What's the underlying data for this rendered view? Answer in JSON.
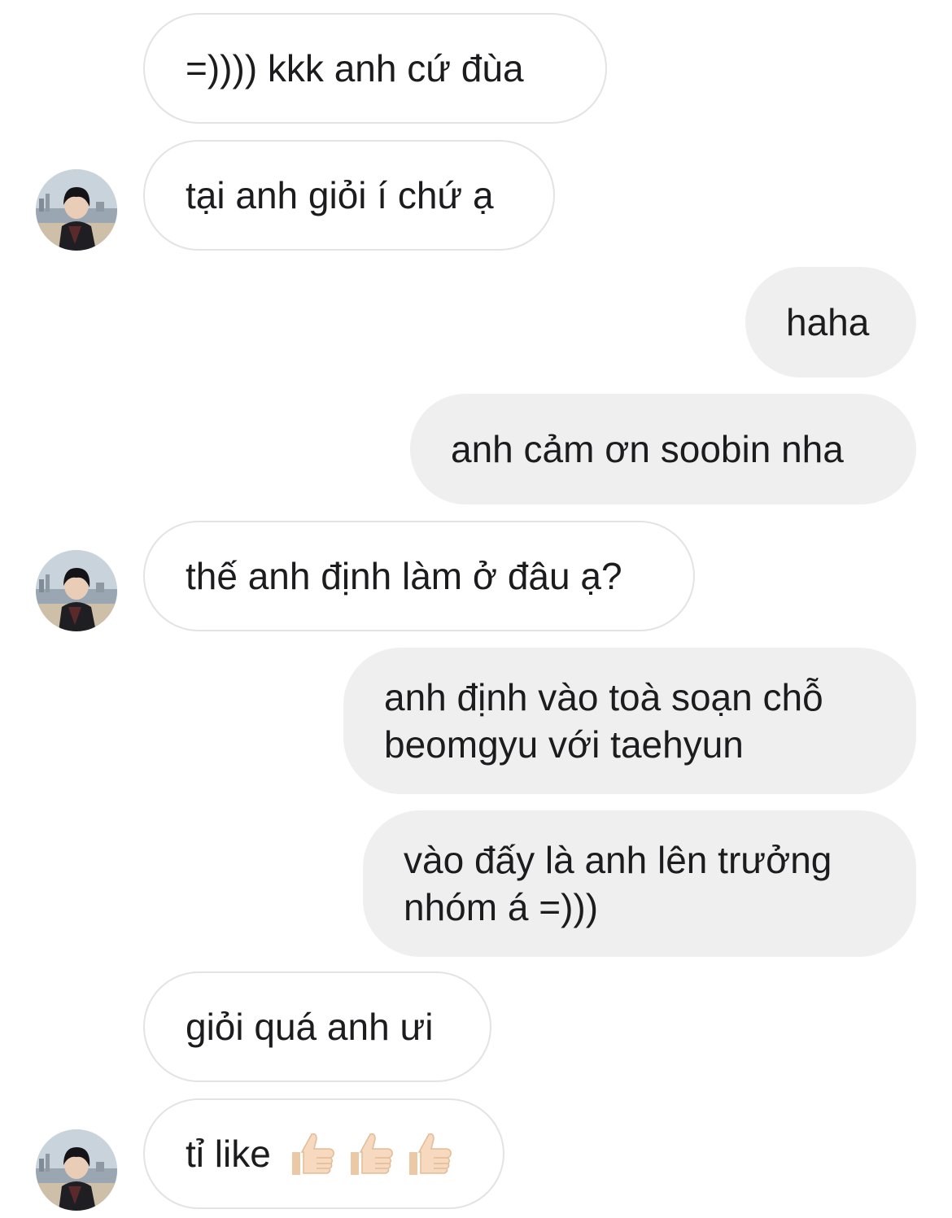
{
  "messages": [
    {
      "side": "in",
      "text": "=)))) kkk anh cứ đùa"
    },
    {
      "side": "in",
      "text": "tại anh giỏi í chứ ạ",
      "avatar": true
    },
    {
      "side": "out",
      "text": "haha"
    },
    {
      "side": "out",
      "text": "anh cảm ơn soobin nha"
    },
    {
      "side": "in",
      "text": "thế anh định làm ở đâu ạ?",
      "avatar": true
    },
    {
      "side": "out",
      "text": "anh định vào toà soạn chỗ\nbeomgyu với taehyun"
    },
    {
      "side": "out",
      "text": "vào đấy là anh lên trưởng\nnhóm á =)))"
    },
    {
      "side": "in",
      "text": "giỏi quá anh ưi"
    },
    {
      "side": "in",
      "text": "tỉ like",
      "emoji": [
        "thumbs-up",
        "thumbs-up",
        "thumbs-up"
      ],
      "avatar": true
    }
  ],
  "colors": {
    "incoming_bubble_bg": "#ffffff",
    "incoming_bubble_border": "#e3e3e3",
    "outgoing_bubble_bg": "#efefef",
    "text": "#1c1c1e",
    "emoji_skin": "#f6d9bf"
  }
}
